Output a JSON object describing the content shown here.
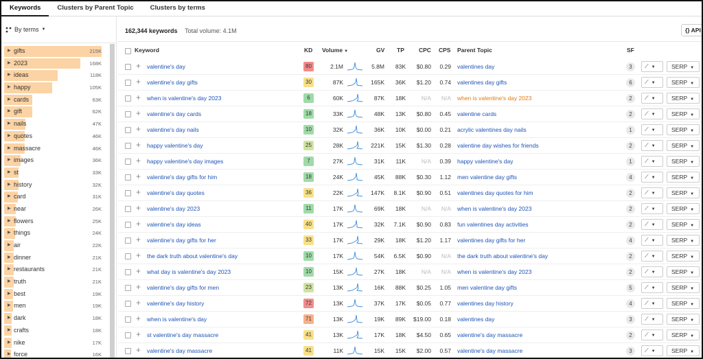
{
  "tabs": [
    {
      "label": "Keywords"
    },
    {
      "label": "Clusters by Parent Topic"
    },
    {
      "label": "Clusters by terms"
    }
  ],
  "sidebar": {
    "by_terms_label": "By terms",
    "terms": [
      {
        "label": "gifts",
        "count": "215K",
        "share": 1.0
      },
      {
        "label": "2023",
        "count": "168K",
        "share": 0.78
      },
      {
        "label": "ideas",
        "count": "118K",
        "share": 0.55
      },
      {
        "label": "happy",
        "count": "105K",
        "share": 0.49
      },
      {
        "label": "cards",
        "count": "63K",
        "share": 0.29
      },
      {
        "label": "gift",
        "count": "62K",
        "share": 0.29
      },
      {
        "label": "nails",
        "count": "47K",
        "share": 0.22
      },
      {
        "label": "quotes",
        "count": "46K",
        "share": 0.21
      },
      {
        "label": "massacre",
        "count": "46K",
        "share": 0.21
      },
      {
        "label": "images",
        "count": "36K",
        "share": 0.17
      },
      {
        "label": "st",
        "count": "33K",
        "share": 0.15
      },
      {
        "label": "history",
        "count": "32K",
        "share": 0.15
      },
      {
        "label": "card",
        "count": "31K",
        "share": 0.14
      },
      {
        "label": "near",
        "count": "26K",
        "share": 0.12
      },
      {
        "label": "flowers",
        "count": "25K",
        "share": 0.12
      },
      {
        "label": "things",
        "count": "24K",
        "share": 0.11
      },
      {
        "label": "air",
        "count": "22K",
        "share": 0.1
      },
      {
        "label": "dinner",
        "count": "21K",
        "share": 0.1
      },
      {
        "label": "restaurants",
        "count": "21K",
        "share": 0.1
      },
      {
        "label": "truth",
        "count": "21K",
        "share": 0.1
      },
      {
        "label": "best",
        "count": "19K",
        "share": 0.09
      },
      {
        "label": "men",
        "count": "19K",
        "share": 0.09
      },
      {
        "label": "dark",
        "count": "18K",
        "share": 0.08
      },
      {
        "label": "crafts",
        "count": "18K",
        "share": 0.08
      },
      {
        "label": "nike",
        "count": "17K",
        "share": 0.08
      },
      {
        "label": "force",
        "count": "16K",
        "share": 0.07
      }
    ]
  },
  "summary": {
    "keywords": "162,344 keywords",
    "total_volume": "Total volume: 4.1M"
  },
  "api_label": "{} API",
  "columns": {
    "keyword": "Keyword",
    "kd": "KD",
    "volume": "Volume",
    "gv": "GV",
    "tp": "TP",
    "cpc": "CPC",
    "cps": "CPS",
    "parent_topic": "Parent Topic",
    "sf": "SF"
  },
  "kd_colors": {
    "very_hard": "#f28b8b",
    "hard": "#f7b08a",
    "medium": "#f7e08a",
    "low": "#cfe3a0",
    "easy": "#9fdba8"
  },
  "rows": [
    {
      "keyword": "valentine's day",
      "kd": "80",
      "kd_level": "very_hard",
      "volume": "2.1M",
      "gv": "5.8M",
      "tp": "83K",
      "cpc": "$0.80",
      "cps": "0.29",
      "parent_topic": "valentines day",
      "pt_orange": false,
      "sf": "3",
      "serp": "SERP"
    },
    {
      "keyword": "valentine's day gifts",
      "kd": "30",
      "kd_level": "medium",
      "volume": "87K",
      "gv": "165K",
      "tp": "36K",
      "cpc": "$1.20",
      "cps": "0.74",
      "parent_topic": "valentines day gifts",
      "pt_orange": false,
      "sf": "6",
      "serp": "SERP"
    },
    {
      "keyword": "when is valentine's day 2023",
      "kd": "6",
      "kd_level": "easy",
      "volume": "60K",
      "gv": "87K",
      "tp": "18K",
      "cpc": "N/A",
      "cps": "N/A",
      "parent_topic": "when is valentine's day 2023",
      "pt_orange": true,
      "sf": "2",
      "serp": "SERP"
    },
    {
      "keyword": "valentine's day cards",
      "kd": "18",
      "kd_level": "easy",
      "volume": "33K",
      "gv": "48K",
      "tp": "13K",
      "cpc": "$0.80",
      "cps": "0.45",
      "parent_topic": "valentine cards",
      "pt_orange": false,
      "sf": "2",
      "serp": "SERP"
    },
    {
      "keyword": "valentine's day nails",
      "kd": "10",
      "kd_level": "easy",
      "volume": "32K",
      "gv": "36K",
      "tp": "10K",
      "cpc": "$0.00",
      "cps": "0.21",
      "parent_topic": "acrylic valentines day nails",
      "pt_orange": false,
      "sf": "1",
      "serp": "SERP"
    },
    {
      "keyword": "happy valentine's day",
      "kd": "25",
      "kd_level": "low",
      "volume": "28K",
      "gv": "221K",
      "tp": "15K",
      "cpc": "$1.30",
      "cps": "0.28",
      "parent_topic": "valentine day wishes for friends",
      "pt_orange": false,
      "sf": "2",
      "serp": "SERP"
    },
    {
      "keyword": "happy valentine's day images",
      "kd": "7",
      "kd_level": "easy",
      "volume": "27K",
      "gv": "31K",
      "tp": "11K",
      "cpc": "N/A",
      "cps": "0.39",
      "parent_topic": "happy valentine's day",
      "pt_orange": false,
      "sf": "1",
      "serp": "SERP"
    },
    {
      "keyword": "valentine's day gifts for him",
      "kd": "18",
      "kd_level": "easy",
      "volume": "24K",
      "gv": "45K",
      "tp": "88K",
      "cpc": "$0.30",
      "cps": "1.12",
      "parent_topic": "men valentine day gifts",
      "pt_orange": false,
      "sf": "4",
      "serp": "SERP"
    },
    {
      "keyword": "valentine's day quotes",
      "kd": "36",
      "kd_level": "medium",
      "volume": "22K",
      "gv": "147K",
      "tp": "8.1K",
      "cpc": "$0.90",
      "cps": "0.51",
      "parent_topic": "valentines day quotes for him",
      "pt_orange": false,
      "sf": "2",
      "serp": "SERP"
    },
    {
      "keyword": "valentine's day 2023",
      "kd": "11",
      "kd_level": "easy",
      "volume": "17K",
      "gv": "69K",
      "tp": "18K",
      "cpc": "N/A",
      "cps": "N/A",
      "parent_topic": "when is valentine's day 2023",
      "pt_orange": false,
      "sf": "2",
      "serp": "SERP"
    },
    {
      "keyword": "valentine's day ideas",
      "kd": "40",
      "kd_level": "medium",
      "volume": "17K",
      "gv": "32K",
      "tp": "7.1K",
      "cpc": "$0.90",
      "cps": "0.83",
      "parent_topic": "fun valentines day activities",
      "pt_orange": false,
      "sf": "2",
      "serp": "SERP"
    },
    {
      "keyword": "valentine's day gifts for her",
      "kd": "33",
      "kd_level": "medium",
      "volume": "17K",
      "gv": "29K",
      "tp": "18K",
      "cpc": "$1.20",
      "cps": "1.17",
      "parent_topic": "valentines day gifts for her",
      "pt_orange": false,
      "sf": "4",
      "serp": "SERP"
    },
    {
      "keyword": "the dark truth about valentine's day",
      "kd": "10",
      "kd_level": "easy",
      "volume": "17K",
      "gv": "54K",
      "tp": "6.5K",
      "cpc": "$0.90",
      "cps": "N/A",
      "parent_topic": "the dark truth about valentine's day",
      "pt_orange": false,
      "sf": "2",
      "serp": "SERP"
    },
    {
      "keyword": "what day is valentine's day 2023",
      "kd": "10",
      "kd_level": "easy",
      "volume": "15K",
      "gv": "27K",
      "tp": "18K",
      "cpc": "N/A",
      "cps": "N/A",
      "parent_topic": "when is valentine's day 2023",
      "pt_orange": false,
      "sf": "2",
      "serp": "SERP"
    },
    {
      "keyword": "valentine's day gifts for men",
      "kd": "23",
      "kd_level": "low",
      "volume": "13K",
      "gv": "16K",
      "tp": "88K",
      "cpc": "$0.25",
      "cps": "1.05",
      "parent_topic": "men valentine day gifts",
      "pt_orange": false,
      "sf": "5",
      "serp": "SERP"
    },
    {
      "keyword": "valentine's day history",
      "kd": "72",
      "kd_level": "very_hard",
      "volume": "13K",
      "gv": "37K",
      "tp": "17K",
      "cpc": "$0.05",
      "cps": "0.77",
      "parent_topic": "valentines day history",
      "pt_orange": false,
      "sf": "4",
      "serp": "SERP"
    },
    {
      "keyword": "when is valentine's day",
      "kd": "71",
      "kd_level": "hard",
      "volume": "13K",
      "gv": "19K",
      "tp": "89K",
      "cpc": "$19.00",
      "cps": "0.18",
      "parent_topic": "valentines day",
      "pt_orange": false,
      "sf": "3",
      "serp": "SERP"
    },
    {
      "keyword": "st valentine's day massacre",
      "kd": "41",
      "kd_level": "medium",
      "volume": "13K",
      "gv": "17K",
      "tp": "18K",
      "cpc": "$4.50",
      "cps": "0.65",
      "parent_topic": "valentine's day massacre",
      "pt_orange": false,
      "sf": "2",
      "serp": "SERP"
    },
    {
      "keyword": "valentine's day massacre",
      "kd": "41",
      "kd_level": "medium",
      "volume": "11K",
      "gv": "15K",
      "tp": "15K",
      "cpc": "$2.00",
      "cps": "0.57",
      "parent_topic": "valentine's day massacre",
      "pt_orange": false,
      "sf": "3",
      "serp": "SERP"
    }
  ]
}
